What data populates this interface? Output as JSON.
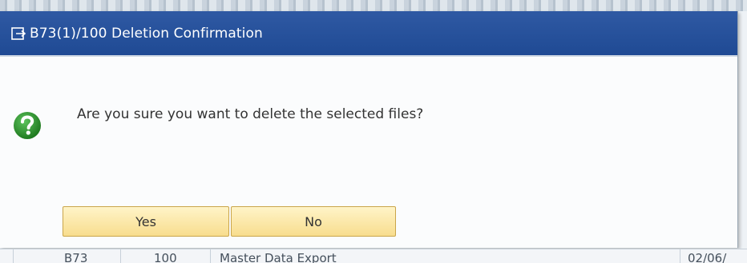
{
  "dialog": {
    "title": "B73(1)/100 Deletion Confirmation",
    "message": "Are you sure you want to delete the selected files?",
    "buttons": {
      "yes": "Yes",
      "no": "No"
    }
  },
  "background_row": {
    "system": "B73",
    "client": "100",
    "description": "Master Data Export",
    "date": "02/06/"
  },
  "colors": {
    "titlebar": "#2f59a3",
    "button_fill": "#f8dd8e",
    "question_icon": "#2e8b2e"
  },
  "icons": {
    "title": "window-icon",
    "message": "question-icon"
  }
}
